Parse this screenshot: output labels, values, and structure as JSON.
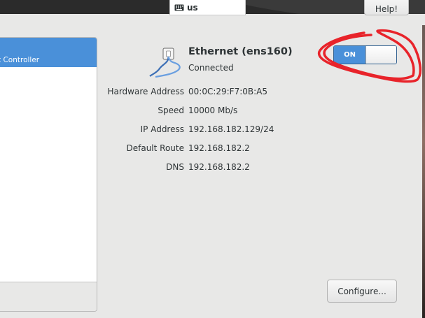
{
  "topbar": {
    "keyboard_layout": "us",
    "help_label": "Help!"
  },
  "device_list": {
    "selected_item_label": "t Controller"
  },
  "device": {
    "name": "Ethernet (ens160)",
    "status": "Connected",
    "toggle_label": "ON",
    "toggle_state": "on"
  },
  "details": [
    {
      "label": "Hardware Address",
      "value": "00:0C:29:F7:0B:A5"
    },
    {
      "label": "Speed",
      "value": "10000 Mb/s"
    },
    {
      "label": "IP Address",
      "value": "192.168.182.129/24"
    },
    {
      "label": "Default Route",
      "value": "192.168.182.2"
    },
    {
      "label": "DNS",
      "value": "192.168.182.2"
    }
  ],
  "buttons": {
    "configure_label": "Configure..."
  },
  "colors": {
    "accent": "#4a90d9",
    "annotation": "#e8232a"
  },
  "icons": {
    "keyboard": "keyboard-icon",
    "network": "ethernet-cable-icon"
  }
}
